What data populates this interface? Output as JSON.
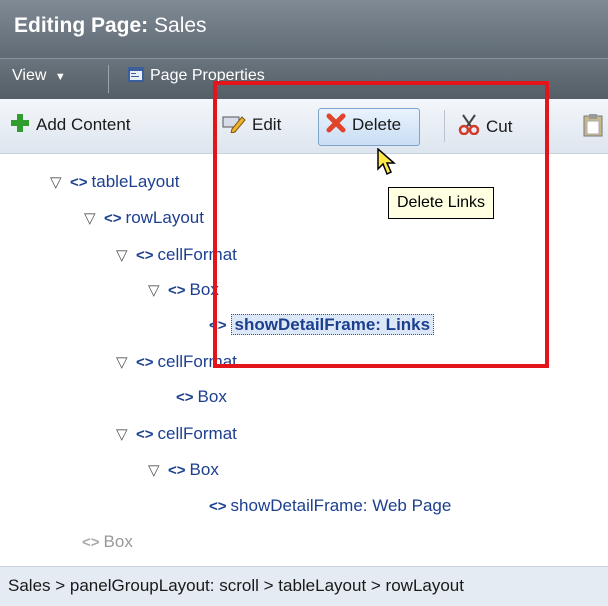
{
  "window": {
    "title_bold": "Editing Page:",
    "title_rest": " Sales"
  },
  "menubar": {
    "view": "View",
    "page_properties": "Page Properties"
  },
  "toolbar": {
    "add_content": "Add Content",
    "edit": "Edit",
    "delete": "Delete",
    "cut": "Cut"
  },
  "tooltip": "Delete Links",
  "tree": [
    {
      "label": "tableLayout"
    },
    {
      "label": "rowLayout"
    },
    {
      "label": "cellFormat"
    },
    {
      "label": "Box"
    },
    {
      "label": "showDetailFrame: Links",
      "selected": true
    },
    {
      "label": "cellFormat"
    },
    {
      "label": "Box"
    },
    {
      "label": "cellFormat"
    },
    {
      "label": "Box"
    },
    {
      "label": "showDetailFrame: Web Page"
    },
    {
      "label": "Box",
      "disabled": true
    }
  ],
  "tree_glyphs": {
    "expanded": "▽",
    "tag": "<>"
  },
  "breadcrumb": "Sales > panelGroupLayout: scroll > tableLayout > rowLayout",
  "colors": {
    "highlight_box": "#e4141b",
    "tooltip_bg": "#ffffe1",
    "tree_text": "#1c3f8f"
  }
}
